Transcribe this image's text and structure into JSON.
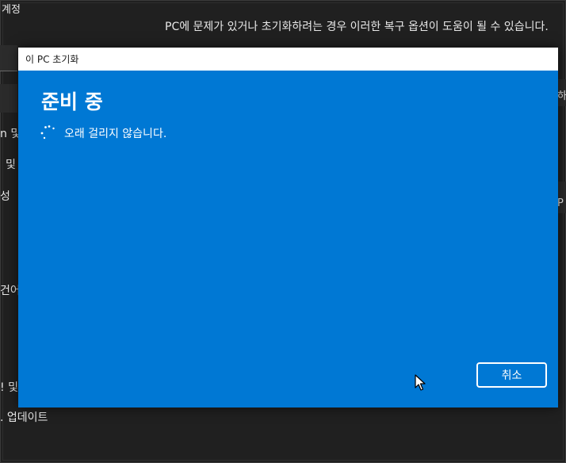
{
  "background": {
    "title": "계정",
    "description": "PC에 문제가 있거나 초기화하려는 경우 이러한 복구 옵션이 도움이 될 수 있습니다.",
    "partial_right_1": "하",
    "partial_right_2": "P",
    "partial_left_1": "n 및",
    "partial_left_2": "및",
    "partial_left_3": "성",
    "partial_left_4": "건어",
    "partial_left_5": "! 및",
    "update_label": ". 업데이트"
  },
  "dialog": {
    "title": "이 PC 초기화",
    "heading": "준비 중",
    "status_text": "오래 걸리지 않습니다.",
    "cancel_label": "취소",
    "accent_color": "#0078d4"
  },
  "icons": {
    "spinner": "loading-spinner-icon",
    "cursor": "mouse-cursor-icon"
  }
}
